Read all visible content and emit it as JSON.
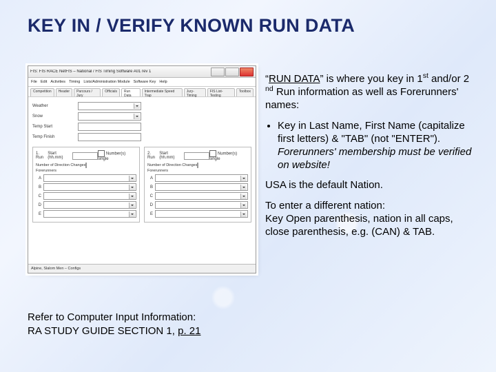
{
  "title": "KEY IN / VERIFY KNOWN RUN DATA",
  "screenshot": {
    "window_title": "FIS: FIS RACE NetFIS – National / FIS Timing Software A01 rev 1",
    "menubar": [
      "File",
      "Edit",
      "Activities",
      "Timing",
      "Lists/Administration Module",
      "Software Key",
      "Help"
    ],
    "tabs": [
      "Competition",
      "Header",
      "Parcours / Jury",
      "Officials",
      "Run Data",
      "Intermediate Speed Trap",
      "Jury-Timing",
      "FIS List-Testing",
      "Toolbox"
    ],
    "active_tab_index": 4,
    "top_fields": [
      {
        "label": "Weather",
        "value": ""
      },
      {
        "label": "Snow",
        "value": ""
      },
      {
        "label": "Temp Start",
        "value": ""
      },
      {
        "label": "Temp Finish",
        "value": ""
      }
    ],
    "panels": [
      {
        "title": "1. Run",
        "start_label": "Start (hh.mm)",
        "start_value": "",
        "chk_label": "Number(s) single",
        "sub_label": "Number of Direction Changes",
        "sub_value": "",
        "fore_label": "Forerunners",
        "rows": [
          "A",
          "B",
          "C",
          "D",
          "E"
        ]
      },
      {
        "title": "2. Run",
        "start_label": "Start (hh.mm)",
        "start_value": "",
        "chk_label": "Number(s) single",
        "sub_label": "Number of Direction Changes",
        "sub_value": "",
        "fore_label": "Forerunners",
        "rows": [
          "A",
          "B",
          "C",
          "D",
          "E"
        ]
      }
    ],
    "status": "Alpine, Slalom Men – Configs"
  },
  "instructions": {
    "p1_a": "“",
    "p1_rundata": "RUN DATA",
    "p1_b": "” is where you key in 1",
    "p1_sup1": "st",
    "p1_c": " and/or 2",
    "p1_sup2": "nd",
    "p1_d": " Run information as well as Forerunners' names:",
    "bullet_plain": "Key in Last Name, First Name (capitalize first letters) & \"TAB\" (not \"ENTER\").  ",
    "bullet_em": "Forerunners' membership must be verified on website!",
    "p2": "USA is the default Nation.",
    "p3": "To enter a different nation:\nKey Open parenthesis, nation in all caps, close parenthesis, e.g. (CAN) & TAB."
  },
  "reference": {
    "line1": "Refer to Computer Input Information:",
    "line2a": "RA STUDY GUIDE SECTION 1, ",
    "line2_pg": "p. 21"
  }
}
